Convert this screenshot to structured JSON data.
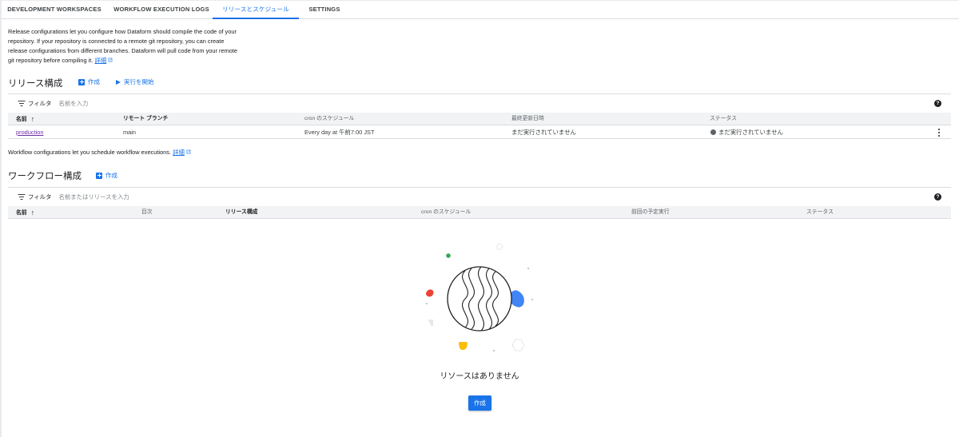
{
  "tabs": [
    {
      "label": "DEVELOPMENT WORKSPACES"
    },
    {
      "label": "WORKFLOW EXECUTION LOGS"
    },
    {
      "label": "リリースとスケジュール"
    },
    {
      "label": "SETTINGS"
    }
  ],
  "active_tab_index": 2,
  "release_description": {
    "line1": "Release configurations let you configure how Dataform should compile the code of your",
    "line2": "repository. If your repository is connected to a remote git repository, you can create",
    "line3": "release configurations from different branches. Dataform will pull code from your remote",
    "line4_prefix": "git repository before compiling it.",
    "link": "詳細"
  },
  "release_section": {
    "title": "リリース構成",
    "create_label": "作成",
    "start_run_label": "実行を開始",
    "filter_label": "フィルタ",
    "filter_placeholder": "名前を入力",
    "columns": [
      "名前",
      "リモート ブランチ",
      "cron のスケジュール",
      "最終更新日時",
      "ステータス"
    ],
    "rows": [
      {
        "name": "production",
        "branch": "main",
        "schedule": "Every day at 午前7:00 JST",
        "last_updated": "まだ実行されていません",
        "status": "まだ実行されていません"
      }
    ]
  },
  "workflow_description": {
    "text": "Workflow configurations let you schedule workflow executions.",
    "link": "詳細"
  },
  "workflow_section": {
    "title": "ワークフロー構成",
    "create_label": "作成",
    "filter_label": "フィルタ",
    "filter_placeholder": "名前またはリリースを入力",
    "columns": [
      "名前",
      "目次",
      "リリース構成",
      "cron のスケジュール",
      "前回の予定実行",
      "ステータス"
    ]
  },
  "empty_state": {
    "message": "リソースはありません",
    "button_label": "作成"
  },
  "colors": {
    "accent": "#1a73e8",
    "link_visited": "#6f2da8",
    "header_bg": "#f1f3f4",
    "status_gray": "#5f6368",
    "illus_red": "#ea4335",
    "illus_green": "#34a853",
    "illus_yellow": "#fbbc04",
    "illus_blue": "#4285f4"
  },
  "icons": {
    "filter": "filter-icon",
    "help": "help-icon",
    "sort": "arrow-upward-icon",
    "more": "more-vert-icon",
    "external": "open-in-new-icon",
    "add": "add-box-icon",
    "play": "play-arrow-icon"
  }
}
